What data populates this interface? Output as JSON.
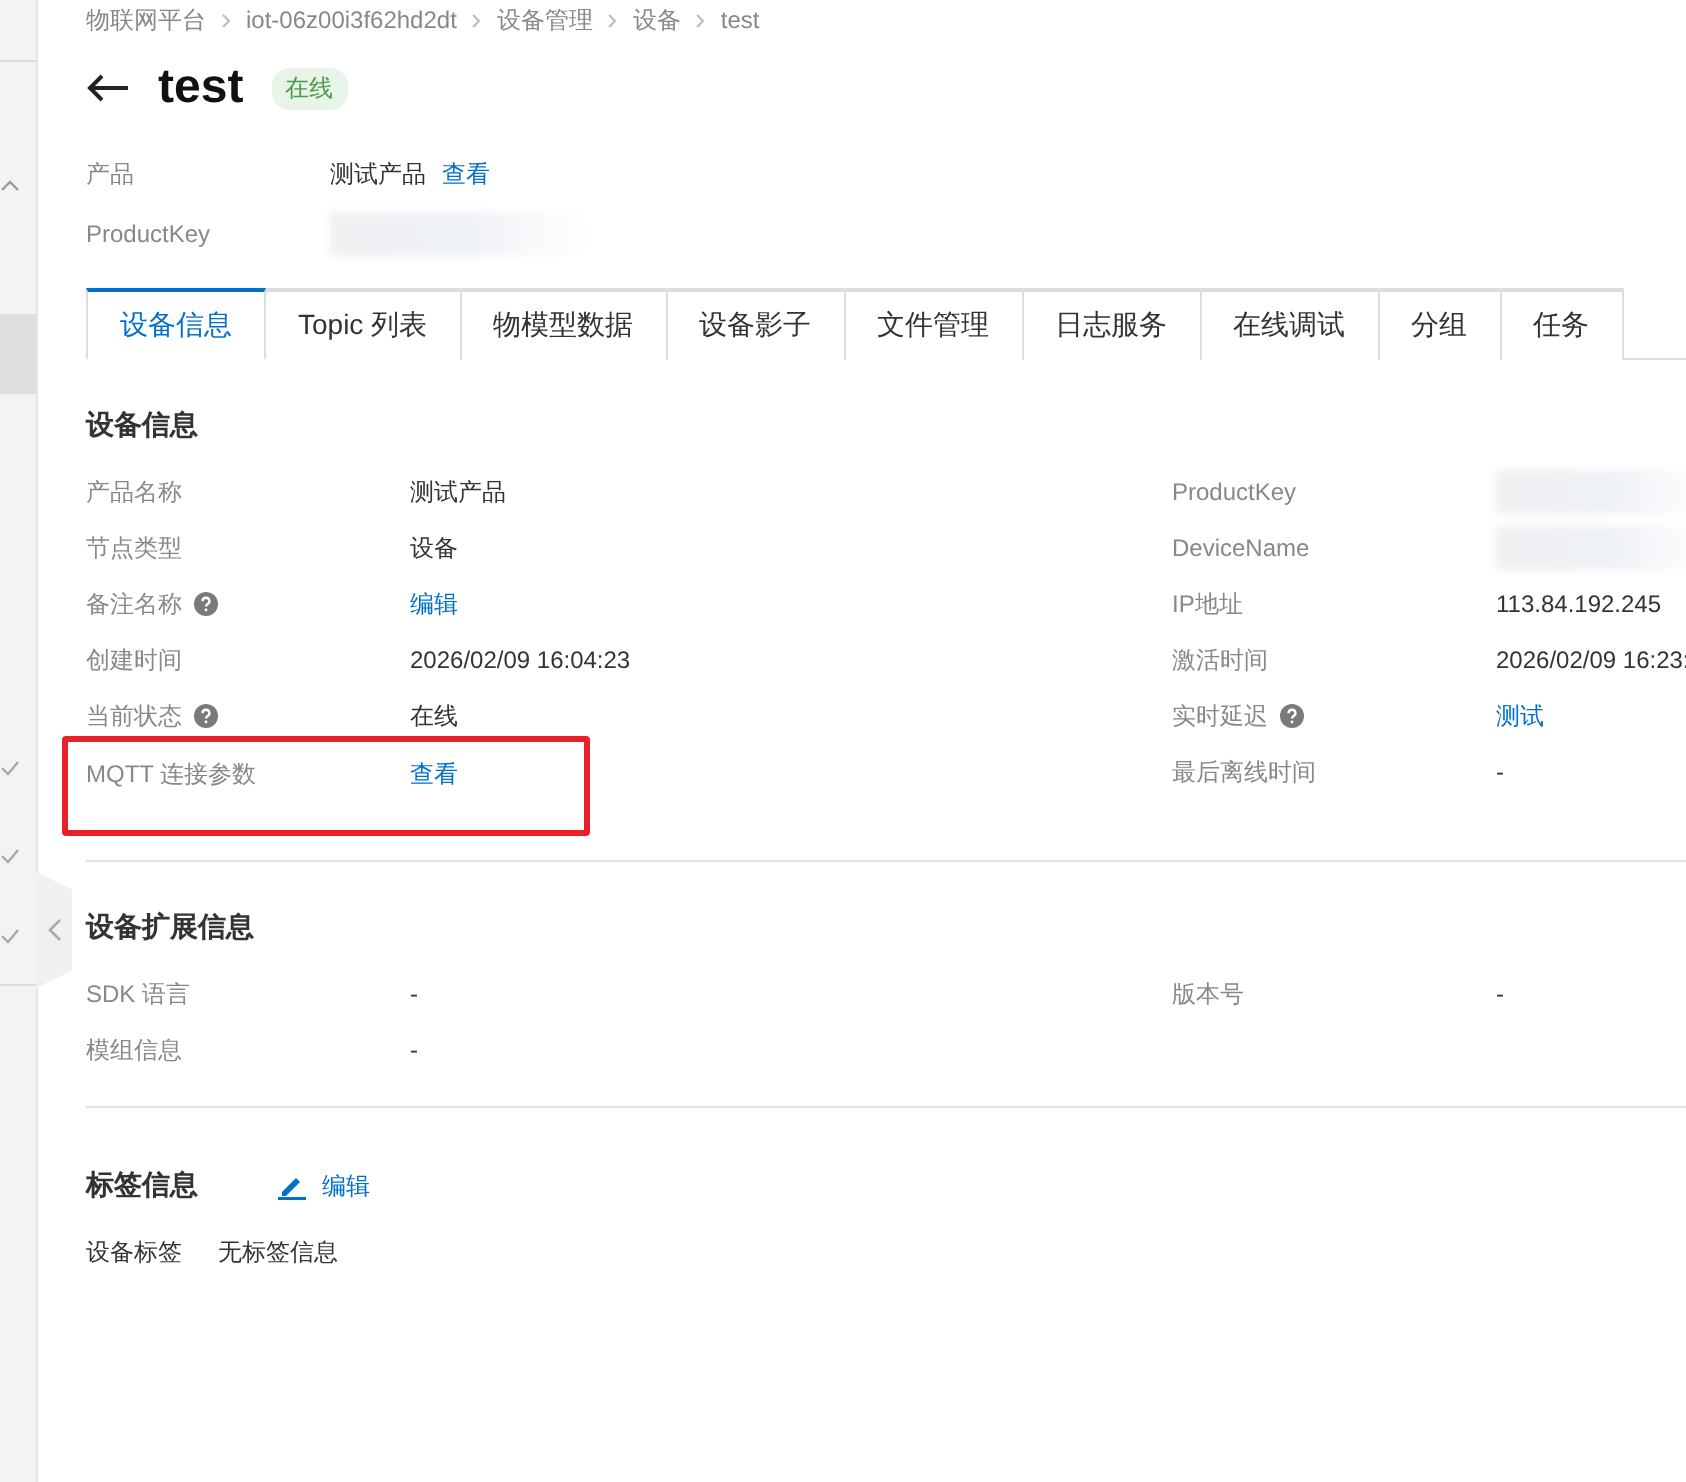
{
  "breadcrumb": [
    "物联网平台",
    "iot-06z00i3f62hd2dt",
    "设备管理",
    "设备",
    "test"
  ],
  "title": "test",
  "status_badge": "在线",
  "summary": [
    {
      "label": "产品",
      "value": "测试产品",
      "link": "查看"
    },
    {
      "label": "ProductKey",
      "redacted": true
    }
  ],
  "tabs": [
    {
      "label": "设备信息",
      "selected": true
    },
    {
      "label": "Topic 列表",
      "selected": false
    },
    {
      "label": "物模型数据",
      "selected": false
    },
    {
      "label": "设备影子",
      "selected": false
    },
    {
      "label": "文件管理",
      "selected": false
    },
    {
      "label": "日志服务",
      "selected": false
    },
    {
      "label": "在线调试",
      "selected": false
    },
    {
      "label": "分组",
      "selected": false
    },
    {
      "label": "任务",
      "selected": false
    }
  ],
  "device_info": {
    "title": "设备信息",
    "left": [
      {
        "label": "产品名称",
        "value": "测试产品",
        "kind": "text"
      },
      {
        "label": "节点类型",
        "value": "设备",
        "kind": "text"
      },
      {
        "label": "备注名称",
        "help": true,
        "value": "编辑",
        "kind": "link"
      },
      {
        "label": "创建时间",
        "value": "2026/02/09 16:04:23",
        "kind": "text"
      },
      {
        "label": "当前状态",
        "help": true,
        "value": "在线",
        "kind": "text"
      },
      {
        "label": "MQTT 连接参数",
        "value": "查看",
        "kind": "link",
        "highlighted": true
      }
    ],
    "right": [
      {
        "label": "ProductKey",
        "kind": "redacted"
      },
      {
        "label": "DeviceName",
        "kind": "redacted"
      },
      {
        "label": "IP地址",
        "value": "113.84.192.245",
        "kind": "text"
      },
      {
        "label": "激活时间",
        "value": "2026/02/09 16:23:",
        "kind": "text"
      },
      {
        "label": "实时延迟",
        "help": true,
        "value": "测试",
        "kind": "link"
      },
      {
        "label": "最后离线时间",
        "value": "-",
        "kind": "text"
      }
    ]
  },
  "extended_info": {
    "title": "设备扩展信息",
    "left": [
      {
        "label": "SDK 语言",
        "value": "-",
        "kind": "text"
      },
      {
        "label": "模组信息",
        "value": "-",
        "kind": "text"
      }
    ],
    "right": [
      {
        "label": "版本号",
        "value": "-",
        "kind": "text"
      }
    ]
  },
  "tag_info": {
    "title": "标签信息",
    "edit": "编辑",
    "label": "设备标签",
    "value": "无标签信息"
  }
}
